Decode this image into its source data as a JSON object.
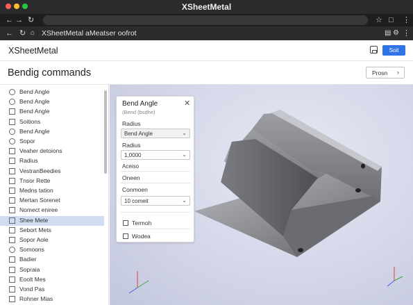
{
  "browser": {
    "title": "XSheetMetal",
    "url": "XSheetMetal aMeatser oofrot",
    "colors": {
      "close": "#ff5f57",
      "minimize": "#febc2e",
      "maximize": "#28c840"
    }
  },
  "header": {
    "app_title": "XSheetMetal",
    "primary_button": "Soit",
    "accent": "#2f73e6"
  },
  "section": {
    "title": "Bendig commands",
    "preview_button": "Prosn"
  },
  "sidebar": {
    "items": [
      {
        "label": "Bend Angle",
        "icon": "circle-icon"
      },
      {
        "label": "Bend Angle",
        "icon": "gear-icon"
      },
      {
        "label": "Bend Angle",
        "icon": "panel-icon"
      },
      {
        "label": "Soitions",
        "icon": "grid-icon"
      },
      {
        "label": "Bend Angle",
        "icon": "gear-icon"
      },
      {
        "label": "Sopor",
        "icon": "circle-icon"
      },
      {
        "label": "Veaher detoions",
        "icon": "grid-icon"
      },
      {
        "label": "Radius",
        "icon": "panel-icon"
      },
      {
        "label": "VestranBeedies",
        "icon": "panel-icon"
      },
      {
        "label": "Tnsor Rette",
        "icon": "grid-icon"
      },
      {
        "label": "Medns tation",
        "icon": "panel-icon"
      },
      {
        "label": "Mertan Sorenet",
        "icon": "panel-icon"
      },
      {
        "label": "Nomect eniree",
        "icon": "panel-icon"
      },
      {
        "label": "Shee Mete",
        "icon": "list-icon",
        "selected": true
      },
      {
        "label": "Sebort Mets",
        "icon": "panel-icon"
      },
      {
        "label": "Sopor Aole",
        "icon": "panel-icon"
      },
      {
        "label": "Somoons",
        "icon": "gear-icon"
      },
      {
        "label": "Badier",
        "icon": "panel-icon"
      },
      {
        "label": "Sopraia",
        "icon": "panel-icon"
      },
      {
        "label": "Eoolt Mes",
        "icon": "panel-icon"
      },
      {
        "label": "Vond Pas",
        "icon": "panel-icon"
      },
      {
        "label": "Rohner Mias",
        "icon": "panel-icon"
      }
    ]
  },
  "panel": {
    "title": "Bend Angle",
    "subtitle": "(Bend (bsdhe)",
    "radius_label": "Radius",
    "radius_select": "Bend Angle",
    "radius2_label": "Radius",
    "radius2_value": "1,0000",
    "aceiso_label": "Aceiso",
    "oneen_label": "Oneen",
    "common_label": "Conmoen",
    "common_select": "10 comeit",
    "check1": "Termoh",
    "check2": "Wodea"
  },
  "viewport": {
    "sheet_color": "#8a8c90"
  }
}
